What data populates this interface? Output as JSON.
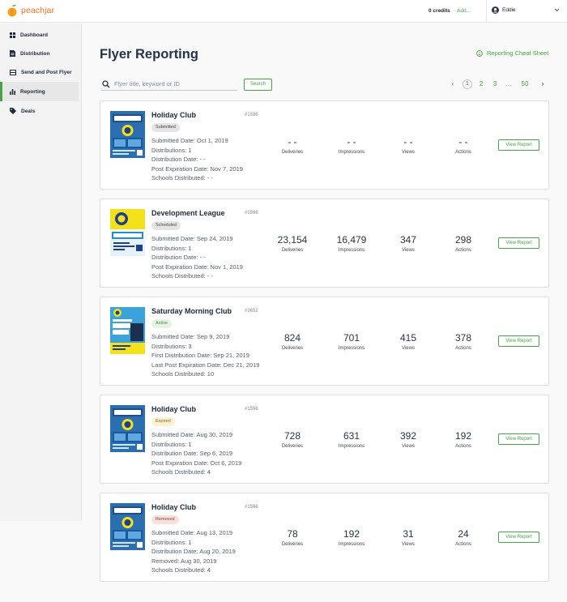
{
  "app": {
    "name": "peachjar"
  },
  "header": {
    "credits": "0 credits",
    "add_label": "Add...",
    "user_name": "Eddie"
  },
  "sidebar": {
    "items": [
      {
        "label": "Dashboard",
        "icon": "grid-icon"
      },
      {
        "label": "Distribution",
        "icon": "document-icon"
      },
      {
        "label": "Send and Post Flyer",
        "icon": "send-icon"
      },
      {
        "label": "Reporting",
        "icon": "bar-chart-icon",
        "active": true
      },
      {
        "label": "Deals",
        "icon": "tag-icon"
      }
    ]
  },
  "page": {
    "title": "Flyer Reporting",
    "cheat_sheet": "Reporting Cheat Sheet"
  },
  "search": {
    "placeholder": "Flyer title, keyword or ID",
    "button": "Search"
  },
  "pagination": {
    "prev": "‹",
    "pages": [
      "1",
      "2",
      "3",
      "...",
      "50"
    ],
    "current": "1",
    "next": "›"
  },
  "stat_labels": {
    "deliveries": "Deliveries",
    "impressions": "Impressions",
    "views": "Views",
    "actions": "Actions"
  },
  "view_report_label": "View Report",
  "flyers": [
    {
      "title": "Holiday Club",
      "id": "#1596",
      "status": "Submitted",
      "details": [
        "Submitted Date: Oct 1, 2019",
        "Distributions: 1",
        "Distribution Date: - -",
        "Post Expiration Date: Nov 7, 2019",
        "Schools Distributed: - -"
      ],
      "deliveries": "- -",
      "impressions": "- -",
      "views": "- -",
      "actions": "- -"
    },
    {
      "title": "Development League",
      "id": "#1596",
      "status": "Scheduled",
      "details": [
        "Submitted Date: Sep 24, 2019",
        "Distributions: 1",
        "Distribution Date: - -",
        "Post Expiration Date: Nov 1, 2019",
        "Schools Distributed: - -"
      ],
      "deliveries": "23,154",
      "impressions": "16,479",
      "views": "347",
      "actions": "298"
    },
    {
      "title": "Saturday Morning Club",
      "id": "#3652",
      "status": "Active",
      "details": [
        "Submitted Date: Sep 9, 2019",
        "Distributions: 3",
        "First Distribution Date: Sep 21, 2019",
        "Last Post Expiration Date: Dec 21, 2019",
        "Schools Distributed: 10"
      ],
      "deliveries": "824",
      "impressions": "701",
      "views": "415",
      "actions": "378"
    },
    {
      "title": "Holiday Club",
      "id": "#1596",
      "status": "Expired",
      "details": [
        "Submitted Date: Aug 30, 2019",
        "Distributions: 1",
        "Distribution Date: Sep 6, 2019",
        "Post Expiration Date: Oct 6, 2019",
        "Schools Distributed: 4"
      ],
      "deliveries": "728",
      "impressions": "631",
      "views": "392",
      "actions": "192"
    },
    {
      "title": "Holiday Club",
      "id": "#1596",
      "status": "Removed",
      "details": [
        "Submitted Date: Aug 13, 2019",
        "Distributions: 1",
        "Distribution Date: Aug 20, 2019",
        "Removed: Aug 30, 2019",
        "Schools Distributed: 4"
      ],
      "deliveries": "78",
      "impressions": "192",
      "views": "31",
      "actions": "24"
    }
  ],
  "thumbnails": {
    "holiday": {
      "text": "HOLIDAY CLUB",
      "color": "#2c6fb0"
    },
    "league": {
      "text": "LEAGUES",
      "color": "#1f8fd6"
    },
    "saturday": {
      "text": "SATURDAY MORNING CLUB",
      "color": "#3aa3dc"
    }
  },
  "colors": {
    "accent": "#47a447",
    "brand_orange": "#f26f21"
  }
}
